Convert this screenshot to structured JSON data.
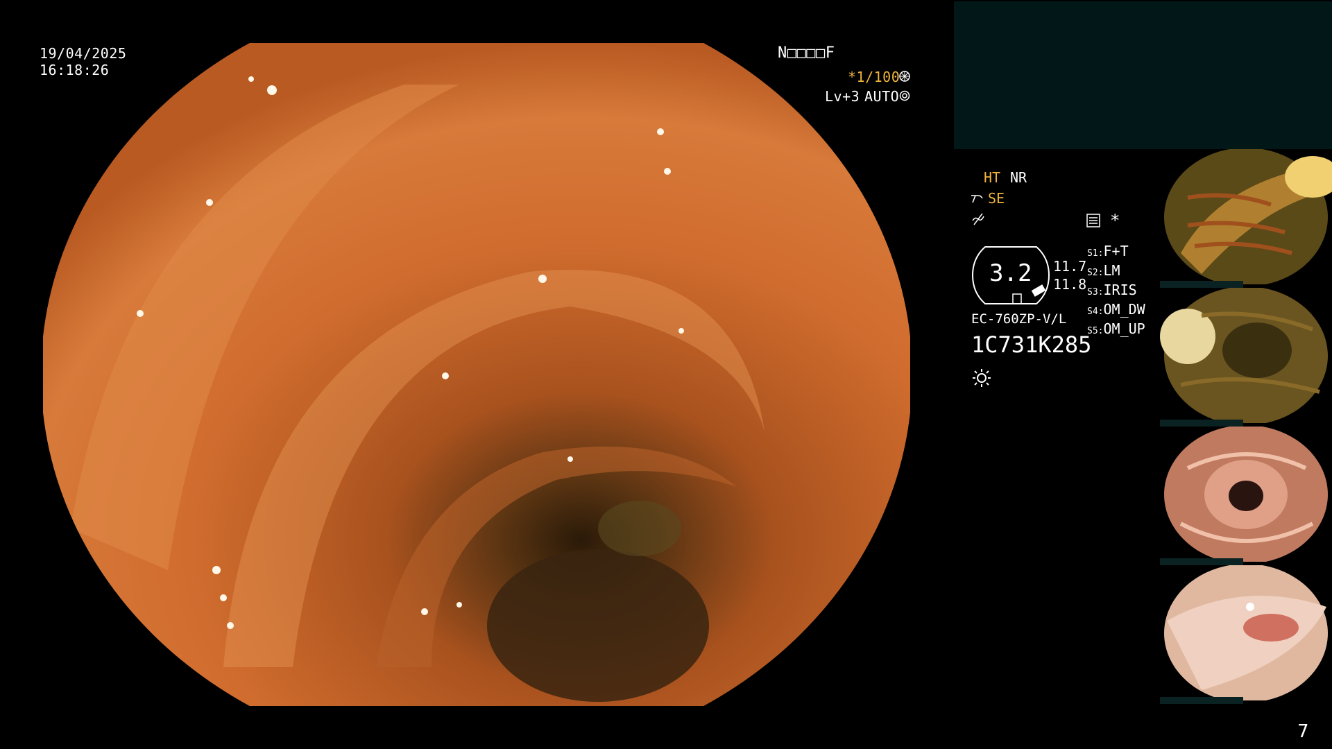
{
  "overlay": {
    "date": "19/04/2025",
    "time": "16:18:26",
    "patient_id": "N□□□□F",
    "shutter": "*1/100",
    "level": "Lv+3",
    "auto": "AUTO"
  },
  "status": {
    "ht": "HT",
    "nr": "NR",
    "se": "SE",
    "asterisk": "*",
    "gauge_value": "3.2",
    "reading_1": "11.7",
    "reading_2": "11.8",
    "scope_model": "EC-760ZP-V/L",
    "serial": "1C731K285",
    "switches": [
      {
        "key": "S1:",
        "value": "F+T"
      },
      {
        "key": "S2:",
        "value": "LM"
      },
      {
        "key": "S3:",
        "value": "IRIS"
      },
      {
        "key": "S4:",
        "value": "OM_DW"
      },
      {
        "key": "S5:",
        "value": "OM_UP"
      }
    ]
  },
  "page_number": "7",
  "colors": {
    "amber": "#f0b43c",
    "side_panel": "#021818",
    "tissue": "#c8662a"
  },
  "icons": [
    "gear-icon",
    "aperture-icon",
    "lamp-icon",
    "menu-icon",
    "scope-icon",
    "wave-icon"
  ]
}
